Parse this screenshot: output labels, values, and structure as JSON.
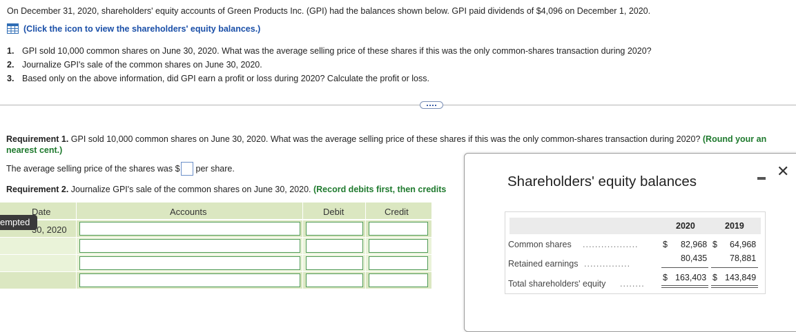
{
  "intro": "On December 31, 2020, shareholders' equity accounts of Green Products Inc. (GPI) had the balances shown below. GPI paid dividends of $4,096 on December 1, 2020.",
  "link": {
    "label": "(Click the icon to view the shareholders' equity balances.)",
    "icon": "table-grid-icon"
  },
  "questions": [
    {
      "num": "1.",
      "text": "GPI sold 10,000 common shares on June 30, 2020. What was the average selling price of these shares if this was the only common-shares transaction during 2020?"
    },
    {
      "num": "2.",
      "text": "Journalize GPI's sale of the common shares on June 30, 2020."
    },
    {
      "num": "3.",
      "text": "Based only on the above information, did GPI earn a profit or loss during 2020? Calculate the profit or loss."
    }
  ],
  "req1": {
    "label": "Requirement 1.",
    "text": " GPI sold 10,000 common shares on June 30, 2020. What was the average selling price of these shares if this was the only common-shares transaction during 2020? ",
    "hint": "(Round your an",
    "hint_cont": "nearest cent.)",
    "answer_prefix": "The average selling price of the shares was $",
    "answer_value": "",
    "answer_suffix": " per share."
  },
  "req2": {
    "label": "Requirement 2.",
    "text": " Journalize GPI's sale of the common shares on June 30, 2020. ",
    "hint": "(Record debits first, then credits"
  },
  "journal": {
    "headers": {
      "date": "Date",
      "accounts": "Accounts",
      "debit": "Debit",
      "credit": "Credit"
    },
    "attempted": "empted",
    "date_value": "30, 2020",
    "rows": 4
  },
  "popup": {
    "title": "Shareholders' equity balances",
    "years": [
      "2020",
      "2019"
    ],
    "rows": [
      {
        "label": "Common shares",
        "dots": "..................",
        "cur_2020": "$",
        "v2020": "82,968",
        "cur_2019": "$",
        "v2019": "64,968"
      },
      {
        "label": "Retained earnings",
        "dots": "...............",
        "cur_2020": "",
        "v2020": "80,435",
        "cur_2019": "",
        "v2019": "78,881"
      },
      {
        "label": "Total shareholders' equity",
        "dots": "........",
        "cur_2020": "$",
        "v2020": "163,403",
        "cur_2019": "$",
        "v2019": "143,849"
      }
    ]
  },
  "colors": {
    "accent_blue": "#1a4fa8",
    "hint_green": "#1f7a2e",
    "table_green": "#dbe7c1",
    "input_border": "#4e9a55"
  }
}
